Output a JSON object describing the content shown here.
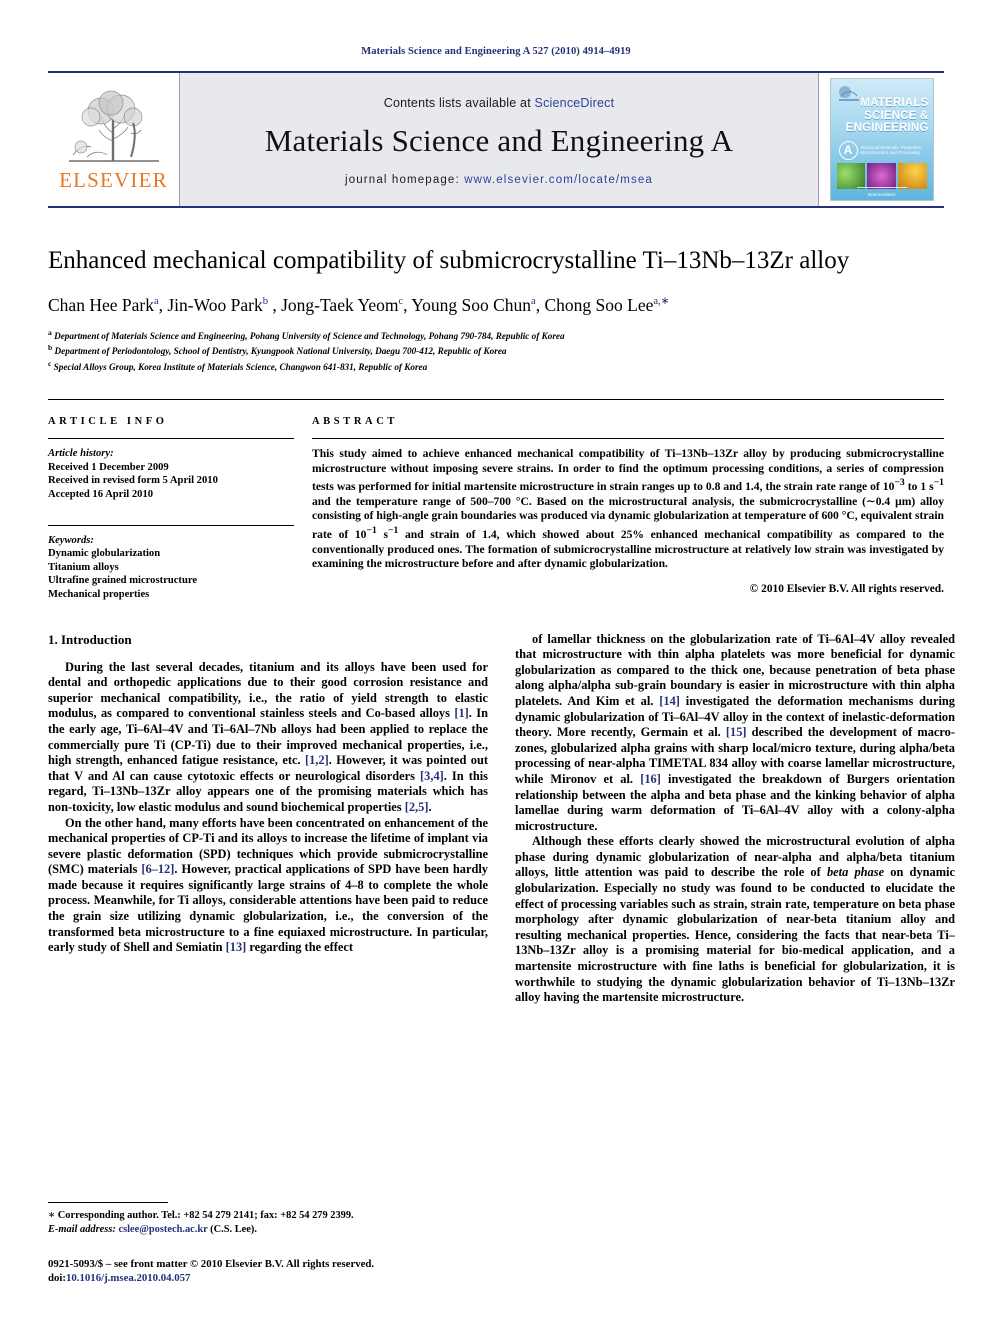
{
  "running_head": "Materials Science and Engineering A 527 (2010) 4914–4919",
  "masthead": {
    "publisher_logo_name": "ELSEVIER",
    "contents_prefix": "Contents lists available at ",
    "contents_link": "ScienceDirect",
    "journal_title": "Materials Science and Engineering A",
    "homepage_prefix": "journal homepage: ",
    "homepage_url": "www.elsevier.com/locate/msea",
    "cover": {
      "line1": "MATERIALS",
      "line2": "SCIENCE &",
      "line3": "ENGINEERING",
      "section_letter": "A",
      "tagline": "Structural Materials: Properties, Microstructure and Processing",
      "footer": "ScienceDirect"
    }
  },
  "article": {
    "title": "Enhanced mechanical compatibility of submicrocrystalline Ti–13Nb–13Zr alloy",
    "authors_html": "Chan Hee Park<sup>a</sup>, Jin-Woo Park<sup>b</sup> , Jong-Taek Yeom<sup>c</sup>, Young Soo Chun<sup>a</sup>, Chong Soo Lee<sup>a,</sup><sup>∗</sup>",
    "affiliations": [
      {
        "marker": "a",
        "text": "Department of Materials Science and Engineering, Pohang University of Science and Technology, Pohang 790-784, Republic of Korea"
      },
      {
        "marker": "b",
        "text": "Department of Periodontology, School of Dentistry, Kyungpook National University, Daegu 700-412, Republic of Korea"
      },
      {
        "marker": "c",
        "text": "Special Alloys Group, Korea Institute of Materials Science, Changwon 641-831, Republic of Korea"
      }
    ]
  },
  "article_info": {
    "heading": "ARTICLE INFO",
    "history_heading": "Article history:",
    "history": [
      "Received 1 December 2009",
      "Received in revised form 5 April 2010",
      "Accepted 16 April 2010"
    ],
    "keywords_heading": "Keywords:",
    "keywords": [
      "Dynamic globularization",
      "Titanium alloys",
      "Ultrafine grained microstructure",
      "Mechanical properties"
    ]
  },
  "abstract": {
    "heading": "ABSTRACT",
    "body_html": "This study aimed to achieve enhanced mechanical compatibility of Ti–13Nb–13Zr alloy by producing submicrocrystalline microstructure without imposing severe strains. In order to find the optimum processing conditions, a series of compression tests was performed for initial martensite microstructure in strain ranges up to 0.8 and 1.4, the strain rate range of 10<sup>−3</sup> to 1 s<sup>−1</sup> and the temperature range of 500–700 °C. Based on the microstructural analysis, the submicrocrystalline (∼0.4 μm) alloy consisting of high-angle grain boundaries was produced via dynamic globularization at temperature of 600 °C, equivalent strain rate of 10<sup>−1</sup> s<sup>−1</sup> and strain of 1.4, which showed about 25% enhanced mechanical compatibility as compared to the conventionally produced ones. The formation of submicrocrystalline microstructure at relatively low strain was investigated by examining the microstructure before and after dynamic globularization.",
    "copyright": "© 2010 Elsevier B.V. All rights reserved."
  },
  "sections": {
    "introduction_heading": "1. Introduction",
    "left_paragraphs_html": [
      "During the last several decades, titanium and its alloys have been used for dental and orthopedic applications due to their good corrosion resistance and superior mechanical compatibility, i.e., the ratio of yield strength to elastic modulus, as compared to conventional stainless steels and Co-based alloys <span class=\"ref\">[1]</span>. In the early age, Ti–6Al–4V and Ti–6Al–7Nb alloys had been applied to replace the commercially pure Ti (CP-Ti) due to their improved mechanical properties, i.e., high strength, enhanced fatigue resistance, etc. <span class=\"ref\">[1,2]</span>. However, it was pointed out that V and Al can cause cytotoxic effects or neurological disorders <span class=\"ref\">[3,4]</span>. In this regard, Ti–13Nb–13Zr alloy appears one of the promising materials which has non-toxicity, low elastic modulus and sound biochemical properties <span class=\"ref\">[2,5]</span>.",
      "On the other hand, many efforts have been concentrated on enhancement of the mechanical properties of CP-Ti and its alloys to increase the lifetime of implant via severe plastic deformation (SPD) techniques which provide submicrocrystalline (SMC) materials <span class=\"ref\">[6–12]</span>. However, practical applications of SPD have been hardly made because it requires significantly large strains of 4–8 to complete the whole process. Meanwhile, for Ti alloys, considerable attentions have been paid to reduce the grain size utilizing dynamic globularization, i.e., the conversion of the transformed beta microstructure to a fine equiaxed microstructure. In particular, early study of Shell and Semiatin <span class=\"ref\">[13]</span> regarding the effect"
    ],
    "right_paragraphs_html": [
      "of lamellar thickness on the globularization rate of Ti–6Al–4V alloy revealed that microstructure with thin alpha platelets was more beneficial for dynamic globularization as compared to the thick one, because penetration of beta phase along alpha/alpha sub-grain boundary is easier in microstructure with thin alpha platelets. And Kim et al. <span class=\"ref\">[14]</span> investigated the deformation mechanisms during dynamic globularization of Ti–6Al–4V alloy in the context of inelastic-deformation theory. More recently, Germain et al. <span class=\"ref\">[15]</span> described the development of macro-zones, globularized alpha grains with sharp local/micro texture, during alpha/beta processing of near-alpha TIMETAL 834 alloy with coarse lamellar microstructure, while Mironov et al. <span class=\"ref\">[16]</span> investigated the breakdown of Burgers orientation relationship between the alpha and beta phase and the kinking behavior of alpha lamellae during warm deformation of Ti–6Al–4V alloy with a colony-alpha microstructure.",
      "Although these efforts clearly showed the microstructural evolution of alpha phase during dynamic globularization of near-alpha and alpha/beta titanium alloys, little attention was paid to describe the role of <span class=\"ital\">beta phase</span> on dynamic globularization. Especially no study was found to be conducted to elucidate the effect of processing variables such as strain, strain rate, temperature on beta phase morphology after dynamic globularization of near-beta titanium alloy and resulting mechanical properties. Hence, considering the facts that near-beta Ti–13Nb–13Zr alloy is a promising material for bio-medical application, and a martensite microstructure with fine laths is beneficial for globularization, it is worthwhile to studying the dynamic globularization behavior of Ti–13Nb–13Zr alloy having the martensite microstructure."
    ]
  },
  "footer": {
    "corresponding_html": "<span class=\"em\">∗</span> Corresponding author. Tel.: +82 54 279 2141; fax: +82 54 279 2399.",
    "email_html": "<span class=\"em\">E-mail address:</span> <span class=\"mail\">cslee@postech.ac.kr</span> (C.S. Lee).",
    "issn_line": "0921-5093/$ – see front matter © 2010 Elsevier B.V. All rights reserved.",
    "doi_prefix": "doi:",
    "doi_value": "10.1016/j.msea.2010.04.057"
  }
}
